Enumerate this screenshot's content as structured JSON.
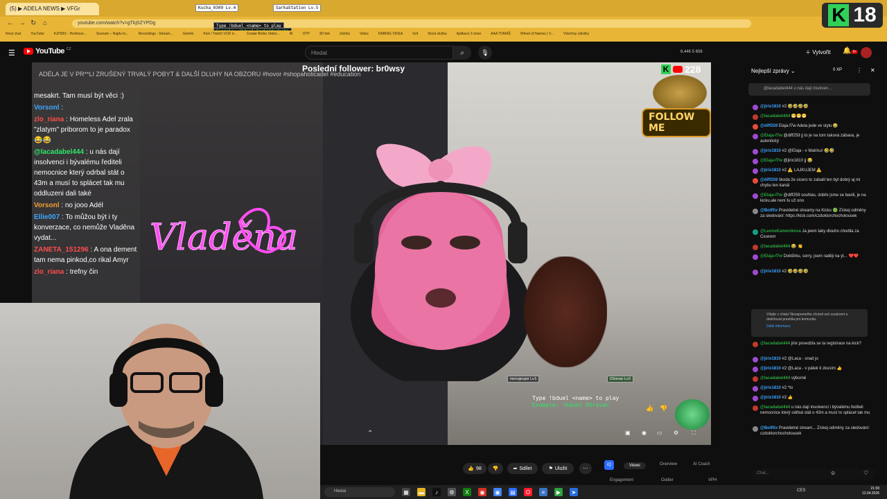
{
  "browser": {
    "tab_title": "(5) ▶ ADELA NEWS ▶ VFGr",
    "url": "youtube.com/watch?v=gTkjSZYPDg",
    "bookmarks": [
      "Nový chat",
      "YouTube",
      "KZH001 - Hodnoce...",
      "Seznam – Najdu to...",
      "Recordings - Stream...",
      "Gemini",
      "Kick / Twitch VOD d...",
      "Create Better Video...",
      "AI",
      "OTP",
      "3D tisk",
      "Zálohy",
      "Video",
      "DABING VIDEA",
      "Grit",
      "Nová složka",
      "Aplikace 3 stran",
      "AAA TOMÁŠ",
      "Wheel of Names | V...",
      "Všechny záložky"
    ]
  },
  "overlays": {
    "kucha_label": "Kucha_0309 Lv.4",
    "sarka_label": "SarkaStation Lv.5",
    "type_cmd": "Type !bduel <name> to play",
    "example_cmd": "Example: !bduel SarkaStudenta",
    "k_logo": "K",
    "k_number": "18"
  },
  "youtube": {
    "logo_text": "YouTube",
    "region": "CZ",
    "search_placeholder": "Hledat",
    "header_stats": "6,446   5   656",
    "create_label": "Vytvořit",
    "notif_count": "9+"
  },
  "video": {
    "top_title": "Poslední follower: br0wsy",
    "ticker": "ADÉLA JE V PR**LI ZRUŠENÝ TRVALÝ POBYT & DALŠÍ DLUHY NA OBZORU #hovor #shopaholicadel #education",
    "neon_text": "Vladěna",
    "follow_text": "FOLLOW ME",
    "sub_count": "228",
    "duel_line1": "Type !bduel <name> to play",
    "duel_line2": "Example: !bduel DSrevan",
    "mini_left": "mercajeuper Lv.5",
    "mini_right": "DSrevan Lv.6"
  },
  "overlay_chat": [
    {
      "name": "",
      "text": "mesakrt. Tam musí být věci :)",
      "color": "#ddd"
    },
    {
      "name": "Vorsonl",
      "text": ":",
      "color": "#3ea6ff"
    },
    {
      "name": "zlo_riana",
      "text": ": Homeless Adel zrala \"zlatym\" priborom to je paradox 😂😂",
      "color": "#ff4d4d"
    },
    {
      "name": "@lacadabel444",
      "text": ": u nás dají insolvenci i bývalému řediteli nemocnice který odrbal stát o 43m a musí to splácet tak mu oddluzeni dali také",
      "color": "#2ee86a"
    },
    {
      "name": "Vorsonl",
      "text": ": no jooo Adél",
      "color": "#f0a030"
    },
    {
      "name": "Ellie007",
      "text": ": To můžou být i ty konverzace, co nemůže Vladěna vydat...",
      "color": "#3ea6ff"
    },
    {
      "name": "ZANETA_151296",
      "text": ": A ona dement tam nema pinkod,co rikal Amyr",
      "color": "#ff4d4d"
    },
    {
      "name": "zlo_riana",
      "text": ": trefny čin",
      "color": "#ff4d4d"
    }
  ],
  "below_video": {
    "likes": "98",
    "share_label": "Sdílet",
    "save_label": "Uložit",
    "tabs": [
      "Views",
      "Overview",
      "AI Coach"
    ],
    "sub_tabs": [
      "Engagement",
      "Outlier",
      "VPH"
    ]
  },
  "chat": {
    "header": "Nejlepší zprávy",
    "xp": "0 XP",
    "pinned": "@lacadabel444 u nás dají insolven...",
    "messages": [
      {
        "name": "@jirix1810",
        "text": "#2 🤣🤣🤣🤣",
        "color": "#a04ad0",
        "cls": ""
      },
      {
        "name": "@lacadabel444",
        "text": "😁😁😁",
        "color": "#c0392b",
        "cls": "g"
      },
      {
        "name": "@diff259",
        "text": "Elaja-f7w Adela jede ve stylu 😂",
        "color": "#e74c3c",
        "cls": ""
      },
      {
        "name": "@Elaja-f7w",
        "text": "@diff259 jj to je na tom taková zábava, je autentický",
        "color": "#a04ad0",
        "cls": "g"
      },
      {
        "name": "@jirix1810",
        "text": "#2 @Elaja - v Matrixu! 🤣🤣",
        "color": "#a04ad0",
        "cls": ""
      },
      {
        "name": "@Elaja-f7w",
        "text": "@jirix1810 jj 😂",
        "color": "#a04ad0",
        "cls": "g"
      },
      {
        "name": "@jirix1810",
        "text": "#2 ⚠️ LAJKUJEM ⚠️",
        "color": "#a04ad0",
        "cls": ""
      },
      {
        "name": "@diff259",
        "text": "škoda že cicero to zabalil ten byl dobrý aj mi chybu ten kanál",
        "color": "#e74c3c",
        "cls": ""
      },
      {
        "name": "@Elaja-f7w",
        "text": "@diff259 souhlas, dobře jsme se bavili, je na kicku,ale není tu už ono",
        "color": "#a04ad0",
        "cls": "g"
      },
      {
        "name": "@BotRix",
        "text": "Pravidelné streamy na Kicku 🟢 Získej odměny za sledování: https://kick.com/czdoktorchocholousek",
        "color": "#888",
        "cls": ""
      },
      {
        "name": "@LeonsKamenikova",
        "text": "Ja jeem taky dlouho chodila za Cicerem",
        "color": "#16a085",
        "cls": "g"
      },
      {
        "name": "@lacadabel444",
        "text": "😂 👏",
        "color": "#c0392b",
        "cls": "g"
      },
      {
        "name": "@Elaja-f7w",
        "text": "Doktůrku, sorry, jsem raději na yt... ❤️❤️",
        "color": "#a04ad0",
        "cls": "g"
      },
      {
        "name": "@jirix1810",
        "text": "#2 🤣🤣🤣🤣",
        "color": "#a04ad0",
        "cls": ""
      }
    ],
    "info_text": "Vítejte v chatu! Nezapomeňte chránit své soukromí a dodržovat pravidla pro komunitu.",
    "info_link": "Další informace",
    "messages2": [
      {
        "name": "@lacadabel444",
        "text": "jirix povedzla se ta registrace na kick?",
        "color": "#c0392b",
        "cls": "g"
      },
      {
        "name": "@jirix1810",
        "text": "#2 @Laca - snad jo",
        "color": "#a04ad0",
        "cls": ""
      },
      {
        "name": "@jirix1810",
        "text": "#2 @Laca - v pátek ti zkusím 👍",
        "color": "#a04ad0",
        "cls": ""
      },
      {
        "name": "@lacadabel444",
        "text": "výborně",
        "color": "#c0392b",
        "cls": "g"
      },
      {
        "name": "@jirix1810",
        "text": "#2 *to",
        "color": "#a04ad0",
        "cls": ""
      },
      {
        "name": "@jirix1810",
        "text": "#2 👍",
        "color": "#a04ad0",
        "cls": ""
      },
      {
        "name": "@lacadabel444",
        "text": "u nás dají insolvenci i bývalému řediteli nemocnice který odrbal stát o 43m a musí to splácet tak mu",
        "color": "#c0392b",
        "cls": "g"
      },
      {
        "name": "@BotRix",
        "text": "Pravidelné stream... Získej odměny za sledování: czdoktorchocholousek",
        "color": "#888",
        "cls": ""
      }
    ],
    "input_placeholder": "Chat..."
  },
  "taskbar": {
    "search_placeholder": "Hledat",
    "lang": "CES",
    "time": "21:09",
    "date": "12.04.2026"
  }
}
